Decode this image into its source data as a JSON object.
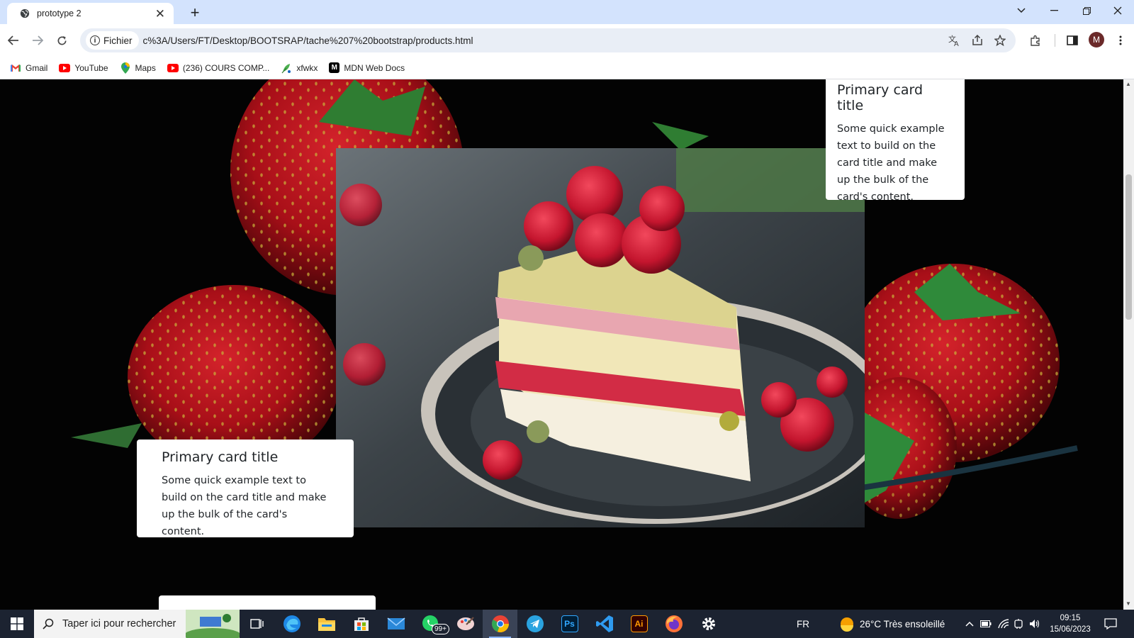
{
  "browser": {
    "tab_title": "prototype 2",
    "tab_close": "✕",
    "new_tab": "+",
    "security_chip": "Fichier",
    "url": "c%3A/Users/FT/Desktop/BOOTSRAP/tache%207%20bootstrap/products.html",
    "profile_initial": "M",
    "bookmarks": [
      {
        "label": "Gmail",
        "icon": "gmail-icon",
        "color": "#ea4335"
      },
      {
        "label": "YouTube",
        "icon": "youtube-icon",
        "color": "#ff0000"
      },
      {
        "label": "Maps",
        "icon": "maps-icon",
        "color": "#34a853"
      },
      {
        "label": "(236) COURS COMP...",
        "icon": "youtube-icon",
        "color": "#ff0000"
      },
      {
        "label": "xfwkx",
        "icon": "leaf-icon",
        "color": "#4caf50"
      },
      {
        "label": "MDN Web Docs",
        "icon": "mdn-icon",
        "color": "#000000"
      }
    ]
  },
  "page": {
    "cards": [
      {
        "title": "Primary card title",
        "text": "Some quick example text to build on the card title and make up the bulk of the card's content."
      },
      {
        "title": "Primary card title",
        "text": "Some quick example text to build on the card title and make up the bulk of the card's content."
      }
    ]
  },
  "taskbar": {
    "search_placeholder": "Taper ici pour rechercher",
    "whatsapp_badge": "99+",
    "language": "FR",
    "weather": "26°C  Très ensoleillé",
    "time": "09:15",
    "date": "15/06/2023",
    "apps": [
      {
        "name": "task-view",
        "label": ""
      },
      {
        "name": "edge",
        "label": "",
        "color": "#1e88e5"
      },
      {
        "name": "file-explorer",
        "label": "",
        "color": "#f9c23c"
      },
      {
        "name": "microsoft-store",
        "label": "",
        "color": "#3b82f6"
      },
      {
        "name": "mail",
        "label": "",
        "color": "#2b88d8"
      },
      {
        "name": "whatsapp",
        "label": "",
        "color": "#25d366"
      },
      {
        "name": "paint",
        "label": "",
        "color": "#e8a0a0"
      },
      {
        "name": "chrome",
        "label": "",
        "color": "#ea4335"
      },
      {
        "name": "telegram",
        "label": "",
        "color": "#2aa3e0"
      },
      {
        "name": "photoshop",
        "label": "Ps",
        "color": "#31a8ff"
      },
      {
        "name": "vscode",
        "label": "",
        "color": "#2f9bf0"
      },
      {
        "name": "illustrator",
        "label": "Ai",
        "color": "#ff9a00"
      },
      {
        "name": "firefox",
        "label": "",
        "color": "#ff7139"
      },
      {
        "name": "settings",
        "label": "",
        "color": "#ffffff"
      }
    ]
  },
  "colors": {
    "tab_strip": "#d3e3fd",
    "omnibox": "#e9eef6",
    "taskbar": "#1c2331",
    "strawberry": "#b5121b",
    "raspberry": "#d81b3c"
  }
}
